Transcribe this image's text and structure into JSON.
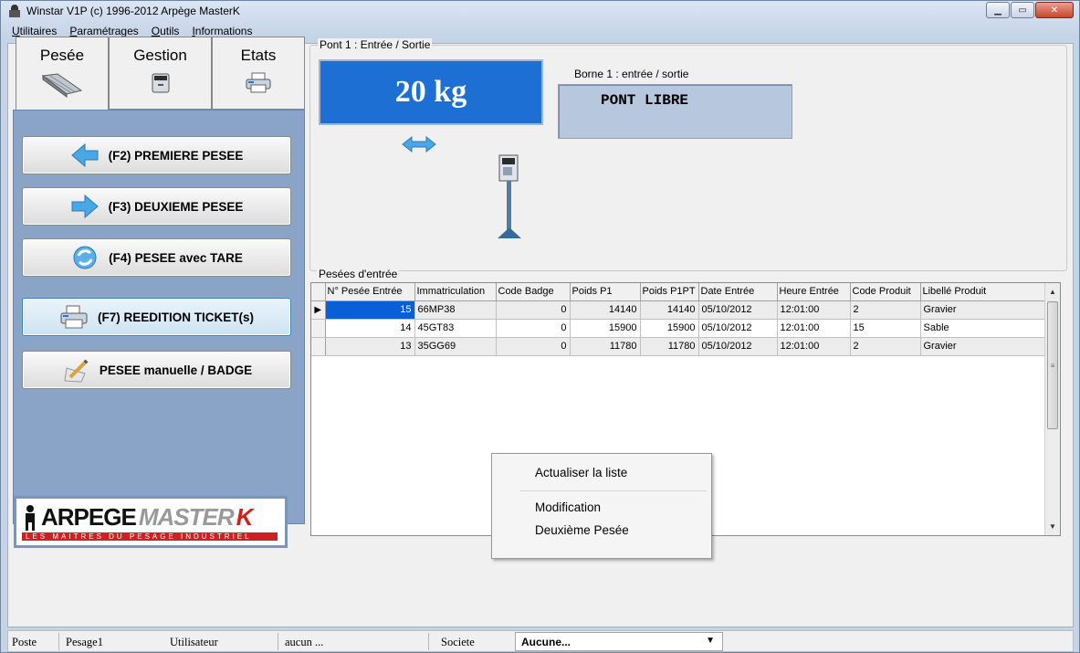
{
  "window": {
    "title": "Winstar V1P (c) 1996-2012 Arpège MasterK"
  },
  "menu": [
    {
      "key": "U",
      "rest": "tilitaires"
    },
    {
      "key": "P",
      "rest": "aramétrages"
    },
    {
      "key": "O",
      "rest": "utils"
    },
    {
      "key": "I",
      "rest": "nformations"
    }
  ],
  "tabs": {
    "pesee": "Pesée",
    "gestion": "Gestion",
    "etats": "Etats"
  },
  "actions": {
    "premiere": "(F2) PREMIERE PESEE",
    "deuxieme": "(F3) DEUXIEME PESEE",
    "tare": "(F4) PESEE avec TARE",
    "reedition": "(F7) REEDITION TICKET(s)",
    "manuelle": "PESEE manuelle / BADGE"
  },
  "logo": {
    "arpege": "ARPEGE",
    "master": "MASTER",
    "k": "K",
    "tagline": "LES MAITRES DU PESAGE INDUSTRIEL"
  },
  "bridge": {
    "group_title": "Pont 1 : Entrée / Sortie",
    "weight": "20 kg",
    "borne_label": "Borne 1 : entrée / sortie",
    "borne_status": "PONT LIBRE"
  },
  "grid": {
    "title": "Pesées d'entrée",
    "columns": [
      "N° Pesée Entrée",
      "Immatriculation",
      "Code Badge",
      "Poids P1",
      "Poids P1PT",
      "Date Entrée",
      "Heure Entrée",
      "Code Produit",
      "Libellé Produit"
    ],
    "rows": [
      [
        "15",
        "66MP38",
        "0",
        "14140",
        "14140",
        "05/10/2012",
        "12:01:00",
        "2",
        "Gravier"
      ],
      [
        "14",
        "45GT83",
        "0",
        "15900",
        "15900",
        "05/10/2012",
        "12:01:00",
        "15",
        "Sable"
      ],
      [
        "13",
        "35GG69",
        "0",
        "11780",
        "11780",
        "05/10/2012",
        "12:01:00",
        "2",
        "Gravier"
      ]
    ]
  },
  "context_menu": {
    "refresh": "Actualiser la liste",
    "modify": "Modification",
    "second": "Deuxième Pesée"
  },
  "status": {
    "poste_label": "Poste",
    "poste_value": "Pesage1",
    "user_label": "Utilisateur",
    "user_value": "aucun ...",
    "societe_label": "Societe",
    "societe_value": "Aucune..."
  }
}
